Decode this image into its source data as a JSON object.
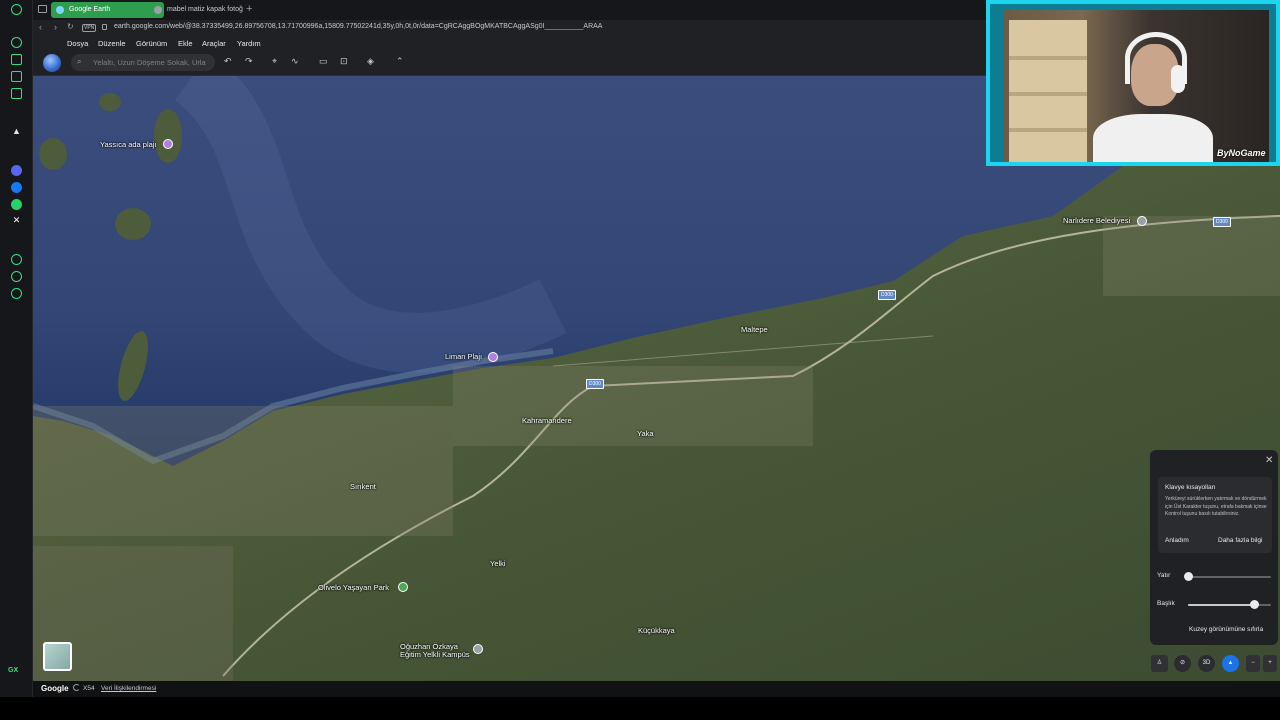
{
  "browser": {
    "tabs": [
      {
        "title": "Google Earth"
      },
      {
        "title": "mabel matiz kapak fotoğ"
      }
    ],
    "vpn_badge": "VPN",
    "url": "earth.google.com/web/@38.37335499,26.89756708,13.71700996a,15809.77502241d,35y,0h,0t,0r/data=CgRCAggBOgMKATBCAggASg0I__________ARAA"
  },
  "earth": {
    "menu": [
      "Dosya",
      "Düzenle",
      "Görünüm",
      "Ekle",
      "Araçlar",
      "Yardım"
    ],
    "search": {
      "placeholder": "Yelaltı, Uzun Döşeme Sokak, Urla"
    }
  },
  "map": {
    "places": [
      {
        "label": "Yassıca ada plajı"
      },
      {
        "label": "Liman Plajı"
      },
      {
        "label": "Narlıdere Belediyesi"
      },
      {
        "label": "Maltepe"
      },
      {
        "label": "Kahramandere"
      },
      {
        "label": "Yaka"
      },
      {
        "label": "Sırıkent"
      },
      {
        "label": "Yelki"
      },
      {
        "label": "Olivelo Yaşayan Park"
      },
      {
        "label": "Oğuzhan Özkaya Eğitim Yelkli Kampüs"
      },
      {
        "label": "Küçükkaya"
      }
    ],
    "road_shields": [
      "D300",
      "D300",
      "D300"
    ]
  },
  "status_bar": {
    "brand": "Google",
    "zoom": "X54",
    "data_link": "Veri İlişkilendirmesi"
  },
  "shortcut_panel": {
    "title": "Klavye kısayolları",
    "body": "Yerküreyi sürüklerken yatırmak ve döndürmek için Üst Karakter tuşunu, etrafa bakmak içinse Kontrol tuşunu basılı tutabilirsiniz.",
    "got_it": "Anladım",
    "learn_more": "Daha fazla bilgi",
    "tilt_label": "Yatır",
    "tilt_value": 0,
    "heading_label": "Başlık",
    "heading_value": 0.8,
    "reset_link": "Kuzey görünümüne sıfırla"
  },
  "controls": {
    "view_3d": "3D"
  },
  "webcam": {
    "brand": "ByNoGame"
  },
  "colors": {
    "active_tab": "#2f9d4e",
    "webcam_border": "#1ed5f0",
    "compass": "#1a73e8",
    "pin_purple": "#b07fe0",
    "pin_green": "#4ca856"
  }
}
